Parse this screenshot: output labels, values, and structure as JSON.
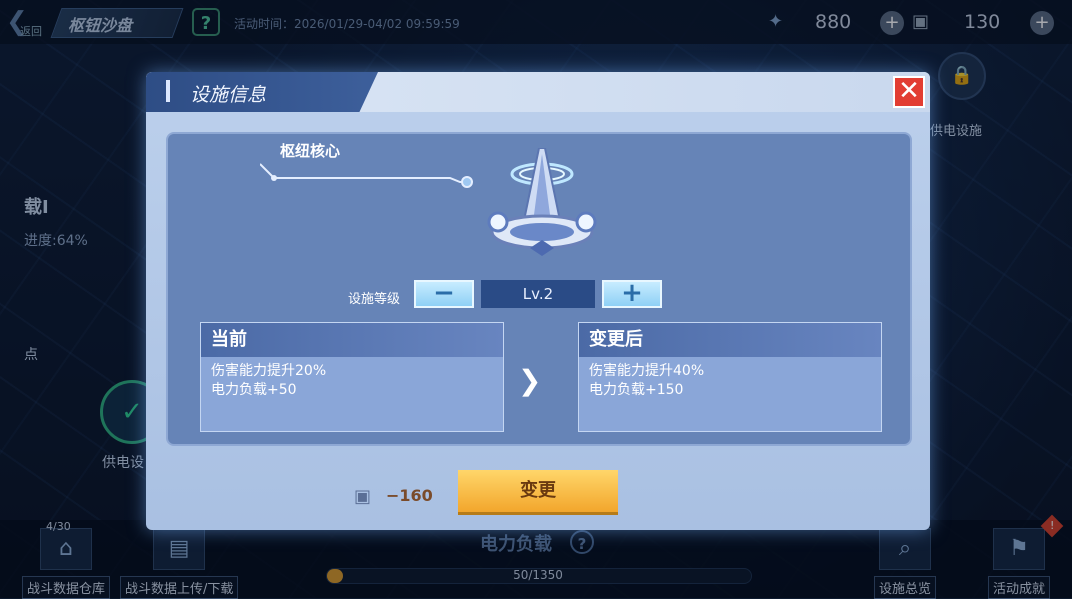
{
  "header": {
    "back_label": "返回",
    "title": "枢钮沙盘",
    "event_time": "活动时间：2026/01/29-04/02 09:59:59",
    "resource1_value": "880",
    "resource2_value": "130"
  },
  "background": {
    "left_label_1": "载I",
    "left_label_2": "进度:64%",
    "left_label_3": "点",
    "left_label_4": "供电设",
    "right_label_1": "供电设施"
  },
  "bottom": {
    "warehouse_count": "4/30",
    "warehouse_label": "战斗数据仓库",
    "upload_label": "战斗数据上传/下载",
    "power_title": "电力负载",
    "power_text": "50/1350",
    "power_fraction": 0.037,
    "overview_label": "设施总览",
    "achievement_label": "活动成就",
    "warn_badge": "!"
  },
  "dialog": {
    "title": "设施信息",
    "close_label": "✕",
    "facility_name": "枢纽核心",
    "level_label": "设施等级",
    "level_value": "Lv.2",
    "minus_label": "−",
    "plus_label": "+",
    "current": {
      "header": "当前",
      "lines": [
        "伤害能力提升20%",
        "电力负载+50"
      ]
    },
    "after": {
      "header": "变更后",
      "lines": [
        "伤害能力提升40%",
        "电力负载+150"
      ]
    },
    "arrow": "❯",
    "cost_value": "−160",
    "change_label": "变更"
  },
  "colors": {
    "close": "#e23d33",
    "change_button": "#f2a62c",
    "level_box": "#2a4b86",
    "panel": "#6684b7"
  }
}
